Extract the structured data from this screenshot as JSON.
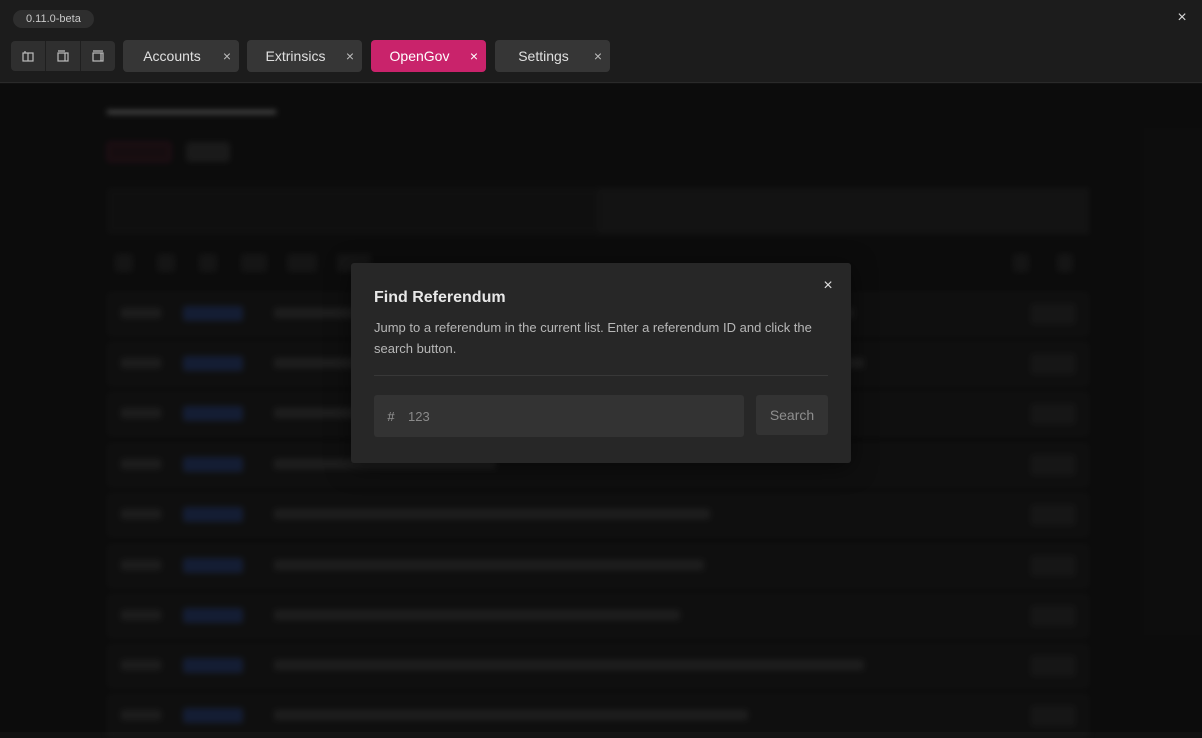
{
  "app": {
    "version": "0.11.0-beta",
    "close_icon": "×"
  },
  "layout_buttons": [
    {
      "icon": "layout-split-icon"
    },
    {
      "icon": "layout-dual-icon"
    },
    {
      "icon": "layout-single-icon"
    }
  ],
  "tabs": [
    {
      "label": "Accounts",
      "active": false,
      "close": "×"
    },
    {
      "label": "Extrinsics",
      "active": false,
      "close": "×"
    },
    {
      "label": "OpenGov",
      "active": true,
      "close": "×"
    },
    {
      "label": "Settings",
      "active": false,
      "close": "×"
    }
  ],
  "colors": {
    "accent": "#c9236b",
    "background": "#111111",
    "modal_bg": "#272727",
    "badge_blue": "#243a70"
  },
  "modal": {
    "title": "Find Referendum",
    "description": "Jump to a referendum in the current list. Enter a referendum ID and click the search button.",
    "input_prefix": "#",
    "input_placeholder": "123",
    "input_value": "",
    "search_label": "Search",
    "close_icon": "×"
  }
}
